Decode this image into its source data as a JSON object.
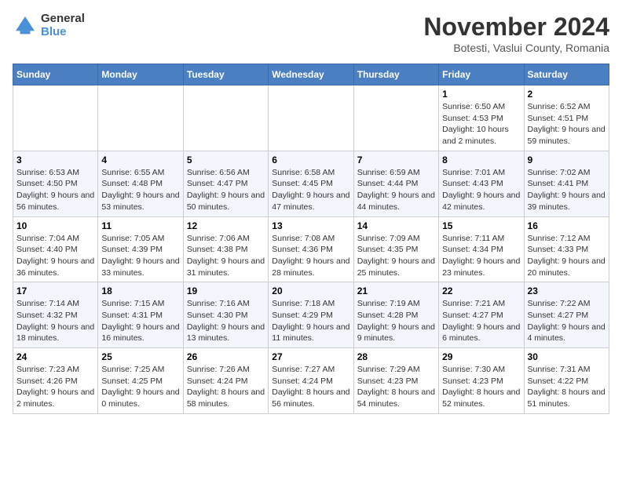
{
  "logo": {
    "general": "General",
    "blue": "Blue"
  },
  "header": {
    "month": "November 2024",
    "location": "Botesti, Vaslui County, Romania"
  },
  "weekdays": [
    "Sunday",
    "Monday",
    "Tuesday",
    "Wednesday",
    "Thursday",
    "Friday",
    "Saturday"
  ],
  "weeks": [
    [
      {
        "day": "",
        "info": ""
      },
      {
        "day": "",
        "info": ""
      },
      {
        "day": "",
        "info": ""
      },
      {
        "day": "",
        "info": ""
      },
      {
        "day": "",
        "info": ""
      },
      {
        "day": "1",
        "info": "Sunrise: 6:50 AM\nSunset: 4:53 PM\nDaylight: 10 hours and 2 minutes."
      },
      {
        "day": "2",
        "info": "Sunrise: 6:52 AM\nSunset: 4:51 PM\nDaylight: 9 hours and 59 minutes."
      }
    ],
    [
      {
        "day": "3",
        "info": "Sunrise: 6:53 AM\nSunset: 4:50 PM\nDaylight: 9 hours and 56 minutes."
      },
      {
        "day": "4",
        "info": "Sunrise: 6:55 AM\nSunset: 4:48 PM\nDaylight: 9 hours and 53 minutes."
      },
      {
        "day": "5",
        "info": "Sunrise: 6:56 AM\nSunset: 4:47 PM\nDaylight: 9 hours and 50 minutes."
      },
      {
        "day": "6",
        "info": "Sunrise: 6:58 AM\nSunset: 4:45 PM\nDaylight: 9 hours and 47 minutes."
      },
      {
        "day": "7",
        "info": "Sunrise: 6:59 AM\nSunset: 4:44 PM\nDaylight: 9 hours and 44 minutes."
      },
      {
        "day": "8",
        "info": "Sunrise: 7:01 AM\nSunset: 4:43 PM\nDaylight: 9 hours and 42 minutes."
      },
      {
        "day": "9",
        "info": "Sunrise: 7:02 AM\nSunset: 4:41 PM\nDaylight: 9 hours and 39 minutes."
      }
    ],
    [
      {
        "day": "10",
        "info": "Sunrise: 7:04 AM\nSunset: 4:40 PM\nDaylight: 9 hours and 36 minutes."
      },
      {
        "day": "11",
        "info": "Sunrise: 7:05 AM\nSunset: 4:39 PM\nDaylight: 9 hours and 33 minutes."
      },
      {
        "day": "12",
        "info": "Sunrise: 7:06 AM\nSunset: 4:38 PM\nDaylight: 9 hours and 31 minutes."
      },
      {
        "day": "13",
        "info": "Sunrise: 7:08 AM\nSunset: 4:36 PM\nDaylight: 9 hours and 28 minutes."
      },
      {
        "day": "14",
        "info": "Sunrise: 7:09 AM\nSunset: 4:35 PM\nDaylight: 9 hours and 25 minutes."
      },
      {
        "day": "15",
        "info": "Sunrise: 7:11 AM\nSunset: 4:34 PM\nDaylight: 9 hours and 23 minutes."
      },
      {
        "day": "16",
        "info": "Sunrise: 7:12 AM\nSunset: 4:33 PM\nDaylight: 9 hours and 20 minutes."
      }
    ],
    [
      {
        "day": "17",
        "info": "Sunrise: 7:14 AM\nSunset: 4:32 PM\nDaylight: 9 hours and 18 minutes."
      },
      {
        "day": "18",
        "info": "Sunrise: 7:15 AM\nSunset: 4:31 PM\nDaylight: 9 hours and 16 minutes."
      },
      {
        "day": "19",
        "info": "Sunrise: 7:16 AM\nSunset: 4:30 PM\nDaylight: 9 hours and 13 minutes."
      },
      {
        "day": "20",
        "info": "Sunrise: 7:18 AM\nSunset: 4:29 PM\nDaylight: 9 hours and 11 minutes."
      },
      {
        "day": "21",
        "info": "Sunrise: 7:19 AM\nSunset: 4:28 PM\nDaylight: 9 hours and 9 minutes."
      },
      {
        "day": "22",
        "info": "Sunrise: 7:21 AM\nSunset: 4:27 PM\nDaylight: 9 hours and 6 minutes."
      },
      {
        "day": "23",
        "info": "Sunrise: 7:22 AM\nSunset: 4:27 PM\nDaylight: 9 hours and 4 minutes."
      }
    ],
    [
      {
        "day": "24",
        "info": "Sunrise: 7:23 AM\nSunset: 4:26 PM\nDaylight: 9 hours and 2 minutes."
      },
      {
        "day": "25",
        "info": "Sunrise: 7:25 AM\nSunset: 4:25 PM\nDaylight: 9 hours and 0 minutes."
      },
      {
        "day": "26",
        "info": "Sunrise: 7:26 AM\nSunset: 4:24 PM\nDaylight: 8 hours and 58 minutes."
      },
      {
        "day": "27",
        "info": "Sunrise: 7:27 AM\nSunset: 4:24 PM\nDaylight: 8 hours and 56 minutes."
      },
      {
        "day": "28",
        "info": "Sunrise: 7:29 AM\nSunset: 4:23 PM\nDaylight: 8 hours and 54 minutes."
      },
      {
        "day": "29",
        "info": "Sunrise: 7:30 AM\nSunset: 4:23 PM\nDaylight: 8 hours and 52 minutes."
      },
      {
        "day": "30",
        "info": "Sunrise: 7:31 AM\nSunset: 4:22 PM\nDaylight: 8 hours and 51 minutes."
      }
    ]
  ]
}
